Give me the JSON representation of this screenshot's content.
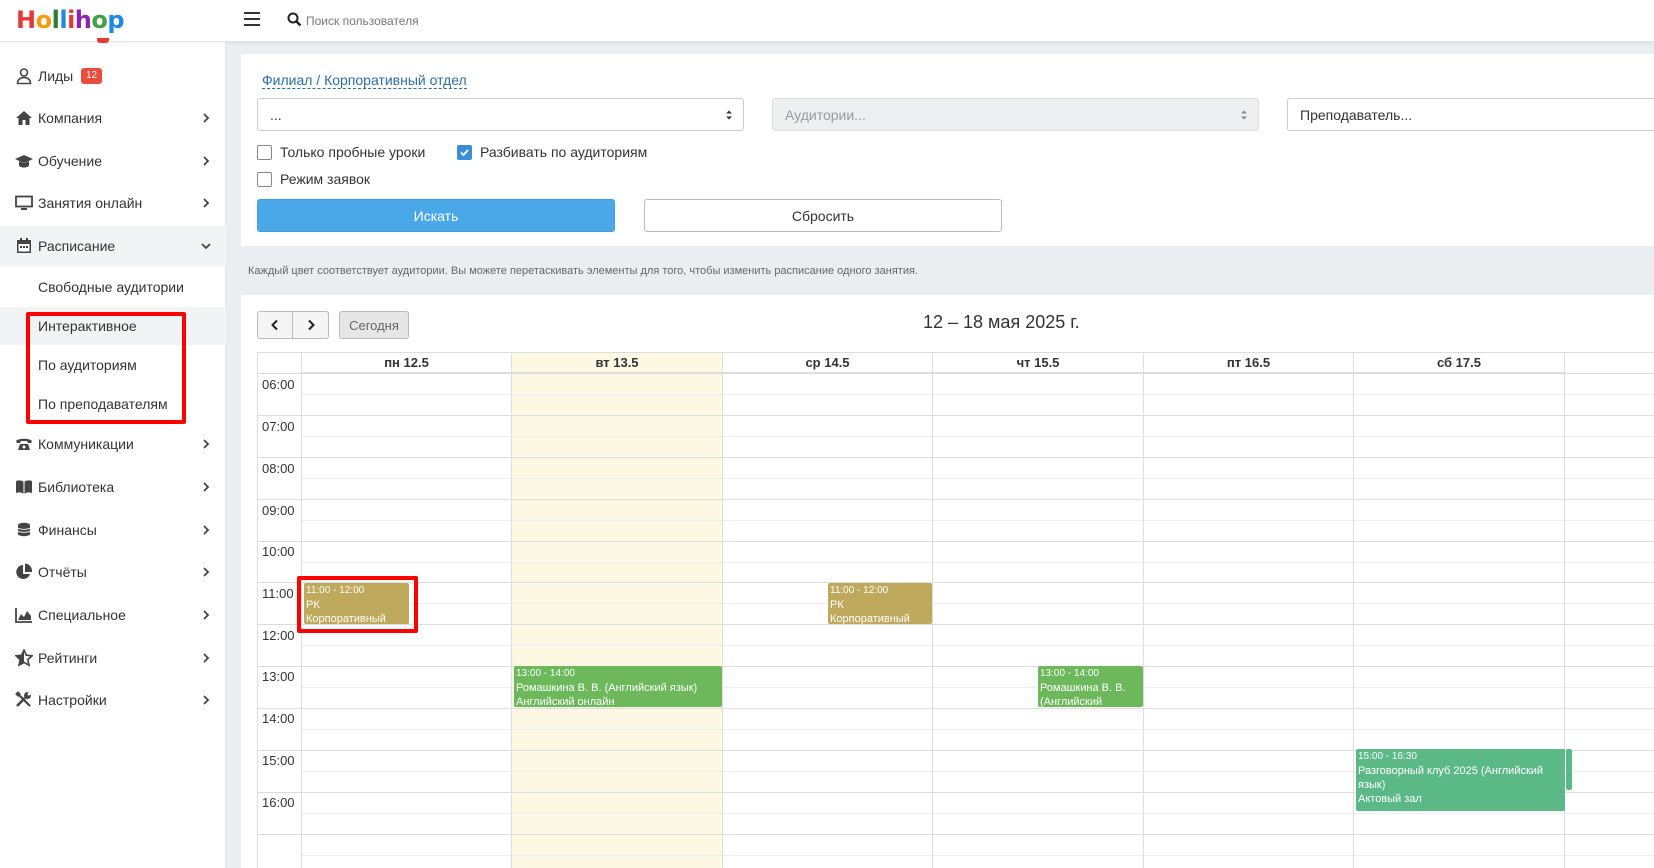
{
  "logo": {
    "text": "Hollihop"
  },
  "header": {
    "search_placeholder": "Поиск пользователя"
  },
  "sidebar": {
    "leads": {
      "label": "Лиды",
      "badge": "12"
    },
    "items": [
      {
        "label": "Компания"
      },
      {
        "label": "Обучение"
      },
      {
        "label": "Занятия онлайн"
      },
      {
        "label": "Расписание"
      },
      {
        "label": "Коммуникации"
      },
      {
        "label": "Библиотека"
      },
      {
        "label": "Финансы"
      },
      {
        "label": "Отчёты"
      },
      {
        "label": "Специальное"
      },
      {
        "label": "Рейтинги"
      },
      {
        "label": "Настройки"
      }
    ],
    "schedule_sub": [
      {
        "label": "Свободные аудитории"
      },
      {
        "label": "Интерактивное"
      },
      {
        "label": "По аудиториям"
      },
      {
        "label": "По преподавателям"
      }
    ]
  },
  "filters": {
    "branch_link": "Филиал / Корпоративный отдел",
    "branch_value": "...",
    "rooms_placeholder": "Аудитории...",
    "teacher_placeholder": "Преподаватель...",
    "only_trial": "Только пробные уроки",
    "split_by_rooms": "Разбивать по аудиториям",
    "requests_mode": "Режим заявок",
    "search_button": "Искать",
    "reset_button": "Сбросить"
  },
  "hint": "Каждый цвет соответствует аудитории. Вы можете перетаскивать элементы для того, чтобы изменить расписание одного занятия.",
  "calendar": {
    "today_button": "Сегодня",
    "title": "12 – 18 мая 2025 г.",
    "days": [
      "пн 12.5",
      "вт 13.5",
      "ср 14.5",
      "чт 15.5",
      "пт 16.5",
      "сб 17.5"
    ],
    "times": [
      "06:00",
      "07:00",
      "08:00",
      "09:00",
      "10:00",
      "11:00",
      "12:00",
      "13:00",
      "14:00",
      "15:00",
      "16:00"
    ],
    "events": [
      {
        "time": "11:00 - 12:00",
        "title": "РК",
        "room": "Корпоративный",
        "color": "#bfa95c"
      },
      {
        "time": "11:00 - 12:00",
        "title": "РК",
        "room": "Корпоративный",
        "color": "#bfa95c"
      },
      {
        "time": "13:00 - 14:00",
        "title": "Ромашкина В. В. (Английский язык)",
        "room": "Английский онлайн",
        "color": "#6cb85a"
      },
      {
        "time": "13:00 - 14:00",
        "title": "Ромашкина В. В.",
        "room": "(Английский",
        "color": "#6cb85a"
      },
      {
        "time": "15:00 - 16:30",
        "title": "Разговорный клуб 2025 (Английский язык)",
        "room": "Актовый зал",
        "color": "#5bb887"
      }
    ]
  },
  "colors": {
    "accent": "#4aa8e8",
    "highlight": "#ff0000",
    "today_bg": "#fcf8e3"
  }
}
